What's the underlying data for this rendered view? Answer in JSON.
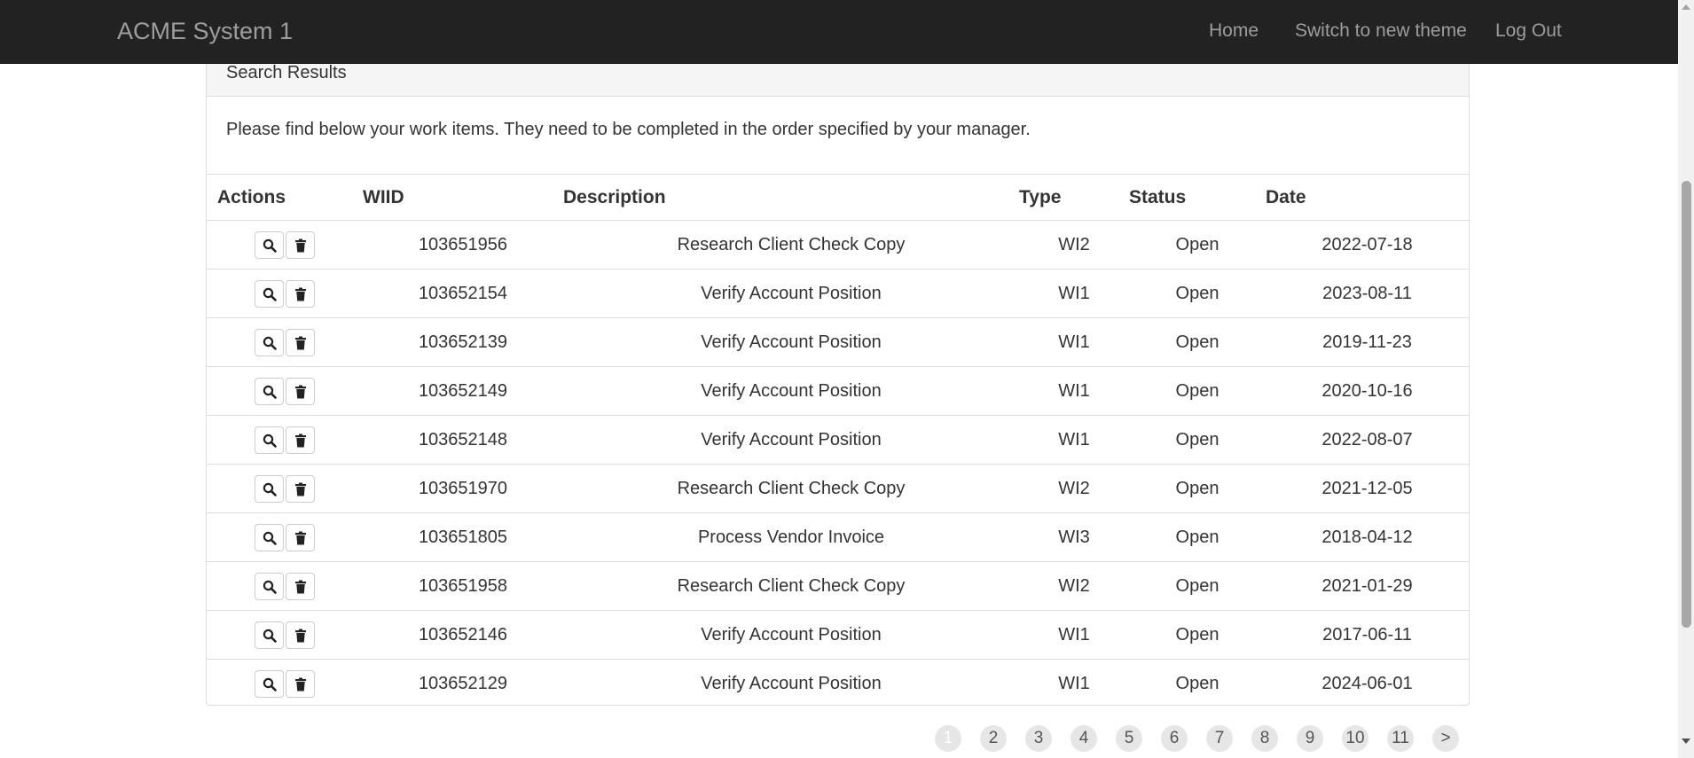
{
  "navbar": {
    "brand": "ACME System 1",
    "links": [
      "Home",
      "Switch to new theme",
      "Log Out"
    ]
  },
  "panel": {
    "title": "Search Results",
    "intro": "Please find below your work items. They need to be completed in the order specified by your manager."
  },
  "table": {
    "headers": [
      "Actions",
      "WIID",
      "Description",
      "Type",
      "Status",
      "Date"
    ],
    "rows": [
      {
        "wiid": "103651956",
        "description": "Research Client Check Copy",
        "type": "WI2",
        "status": "Open",
        "date": "2022-07-18"
      },
      {
        "wiid": "103652154",
        "description": "Verify Account Position",
        "type": "WI1",
        "status": "Open",
        "date": "2023-08-11"
      },
      {
        "wiid": "103652139",
        "description": "Verify Account Position",
        "type": "WI1",
        "status": "Open",
        "date": "2019-11-23"
      },
      {
        "wiid": "103652149",
        "description": "Verify Account Position",
        "type": "WI1",
        "status": "Open",
        "date": "2020-10-16"
      },
      {
        "wiid": "103652148",
        "description": "Verify Account Position",
        "type": "WI1",
        "status": "Open",
        "date": "2022-08-07"
      },
      {
        "wiid": "103651970",
        "description": "Research Client Check Copy",
        "type": "WI2",
        "status": "Open",
        "date": "2021-12-05"
      },
      {
        "wiid": "103651805",
        "description": "Process Vendor Invoice",
        "type": "WI3",
        "status": "Open",
        "date": "2018-04-12"
      },
      {
        "wiid": "103651958",
        "description": "Research Client Check Copy",
        "type": "WI2",
        "status": "Open",
        "date": "2021-01-29"
      },
      {
        "wiid": "103652146",
        "description": "Verify Account Position",
        "type": "WI1",
        "status": "Open",
        "date": "2017-06-11"
      },
      {
        "wiid": "103652129",
        "description": "Verify Account Position",
        "type": "WI1",
        "status": "Open",
        "date": "2024-06-01"
      }
    ],
    "row_actions": {
      "view_icon": "search-icon",
      "delete_icon": "trash-icon"
    }
  },
  "pagination": {
    "pages": [
      "1",
      "2",
      "3",
      "4",
      "5",
      "6",
      "7",
      "8",
      "9",
      "10",
      "11"
    ],
    "current": "1",
    "next_label": ">"
  },
  "colors": {
    "navbar_bg": "#222222",
    "navbar_text": "#9d9d9d",
    "panel_heading_bg": "#f5f5f5",
    "border": "#dddddd",
    "page_button_bg": "#e6e6e6"
  }
}
